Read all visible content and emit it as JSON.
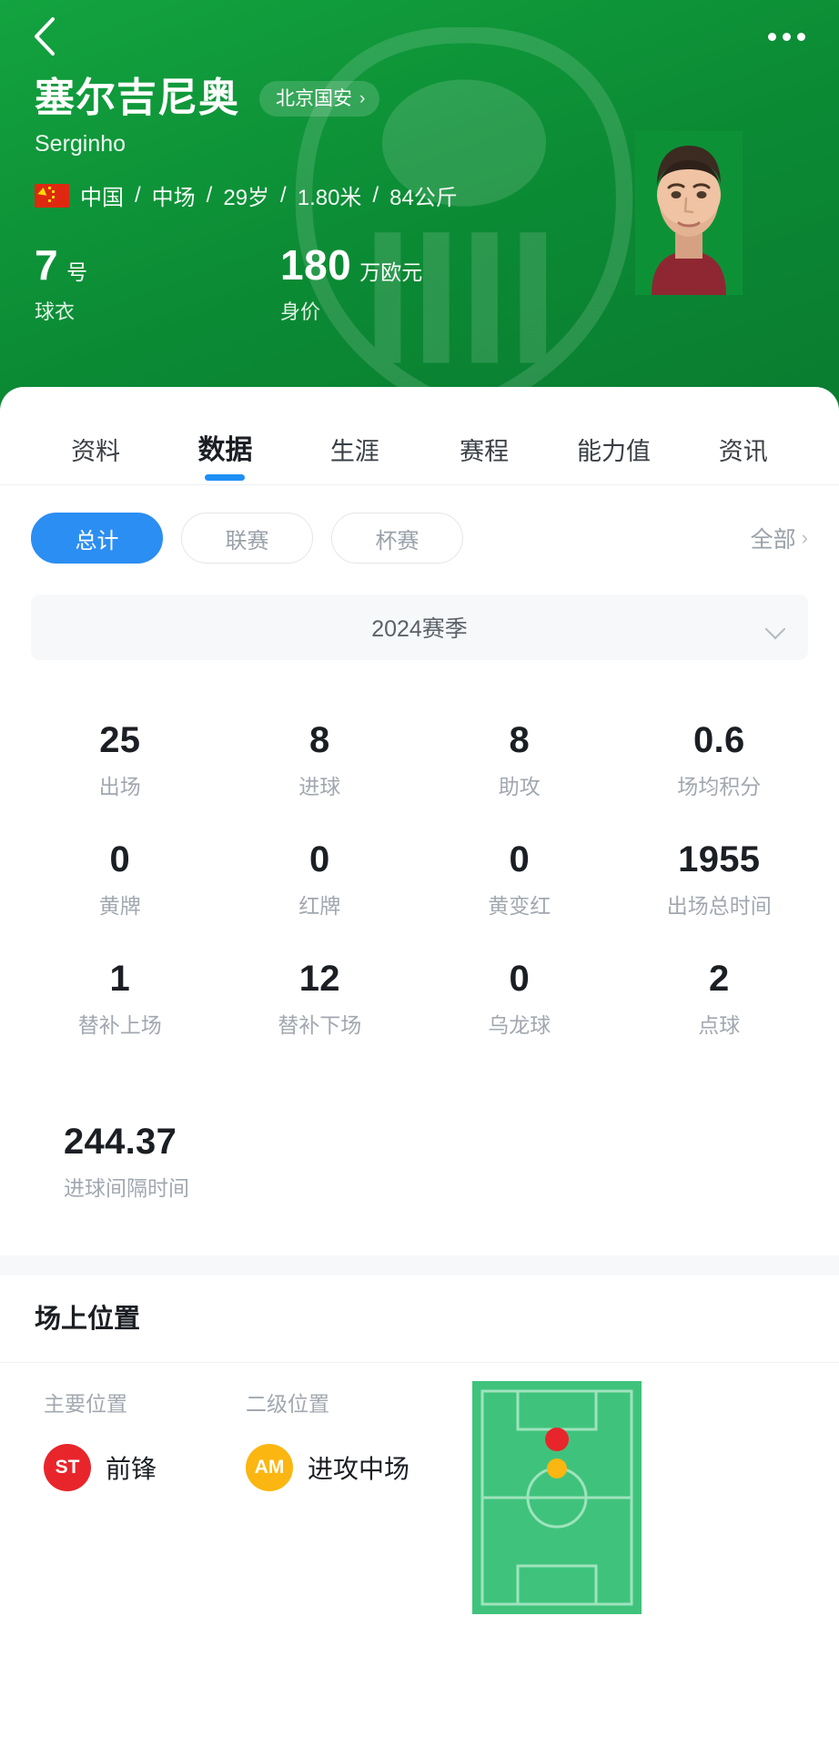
{
  "nav": {
    "back_icon": "chevron-left-icon",
    "more_icon": "more-horizontal-icon"
  },
  "player": {
    "name": "塞尔吉尼奥",
    "alias": "Serginho",
    "team": "北京国安",
    "team_chevron": "›",
    "nationality": "中国",
    "position": "中场",
    "age": "29岁",
    "height": "1.80米",
    "weight": "84公斤",
    "meta_separator": "/",
    "flag_icon": "china-flag-icon",
    "photo_icon": "player-portrait"
  },
  "kpis": [
    {
      "value": "7",
      "unit": "号",
      "label": "球衣"
    },
    {
      "value": "180",
      "unit": "万欧元",
      "label": "身价"
    }
  ],
  "tabs": [
    {
      "label": "资料",
      "active": false
    },
    {
      "label": "数据",
      "active": true
    },
    {
      "label": "生涯",
      "active": false
    },
    {
      "label": "赛程",
      "active": false
    },
    {
      "label": "能力值",
      "active": false
    },
    {
      "label": "资讯",
      "active": false
    }
  ],
  "filters": {
    "chips": [
      {
        "label": "总计",
        "active": true
      },
      {
        "label": "联赛",
        "active": false
      },
      {
        "label": "杯赛",
        "active": false
      }
    ],
    "all_label": "全部",
    "all_chevron": "›"
  },
  "season": {
    "label": "2024赛季",
    "caret_icon": "chevron-down-icon"
  },
  "stats": [
    {
      "value": "25",
      "label": "出场"
    },
    {
      "value": "8",
      "label": "进球"
    },
    {
      "value": "8",
      "label": "助攻"
    },
    {
      "value": "0.6",
      "label": "场均积分"
    },
    {
      "value": "0",
      "label": "黄牌"
    },
    {
      "value": "0",
      "label": "红牌"
    },
    {
      "value": "0",
      "label": "黄变红"
    },
    {
      "value": "1955",
      "label": "出场总时间"
    },
    {
      "value": "1",
      "label": "替补上场"
    },
    {
      "value": "12",
      "label": "替补下场"
    },
    {
      "value": "0",
      "label": "乌龙球"
    },
    {
      "value": "2",
      "label": "点球"
    }
  ],
  "stats_last": [
    {
      "value": "244.37",
      "label": "进球间隔时间"
    }
  ],
  "position_section": {
    "title": "场上位置",
    "primary_head": "主要位置",
    "secondary_head": "二级位置",
    "primary_badge": "ST",
    "primary_name": "前锋",
    "secondary_badge": "AM",
    "secondary_name": "进攻中场",
    "pitch_icon": "football-pitch-diagram"
  },
  "colors": {
    "brand_green": "#0d9137",
    "accent_blue": "#2b8ef3",
    "pitch_green": "#3fc37c",
    "badge_red": "#e8252b",
    "badge_amber": "#fbb611",
    "text_dark": "#1b1f24",
    "text_muted": "#a2a8b0"
  }
}
